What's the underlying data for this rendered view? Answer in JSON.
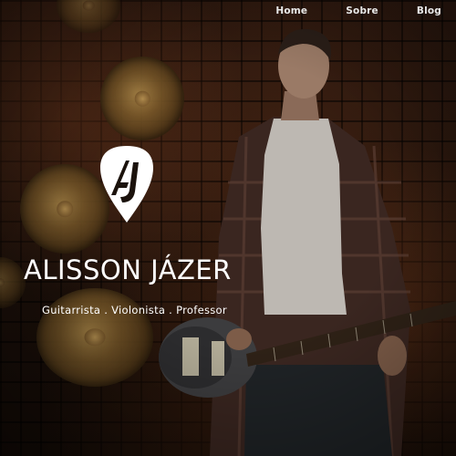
{
  "nav": {
    "home": "Home",
    "sobre": "Sobre",
    "blog": "Blog"
  },
  "logo": {
    "icon": "guitar-pick-aj-monogram",
    "monogram": "AJ"
  },
  "hero": {
    "title": "ALISSON JÁZER",
    "tagline": "Guitarrista . Violonista . Professor"
  },
  "colors": {
    "text": "#ffffff",
    "nav_text": "#e8e8e8",
    "background": "#1e110a"
  }
}
